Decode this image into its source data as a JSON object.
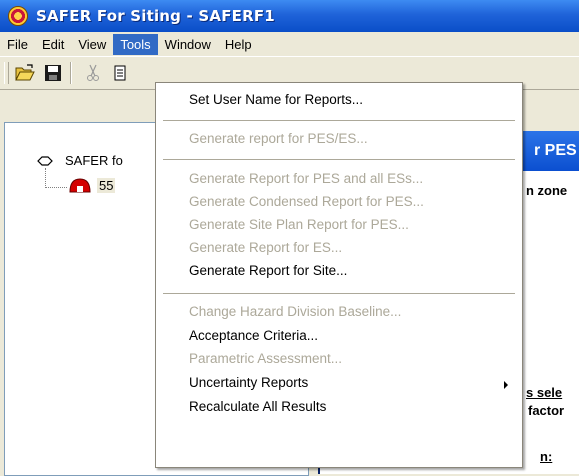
{
  "window": {
    "title": "SAFER For Siting - SAFERF1",
    "app_icon": "safer-app-icon"
  },
  "menubar": {
    "items": [
      {
        "label": "File"
      },
      {
        "label": "Edit"
      },
      {
        "label": "View"
      },
      {
        "label": "Tools",
        "active": true
      },
      {
        "label": "Window"
      },
      {
        "label": "Help"
      }
    ]
  },
  "toolbar": {
    "icons": [
      "open-folder-icon",
      "save-icon",
      "cut-icon",
      "copy-icon"
    ]
  },
  "tree": {
    "root_label": "SAFER fo",
    "child_label": "55",
    "root_icon": "site-node-icon",
    "child_icon": "pes-dome-icon"
  },
  "right_pane": {
    "header_text": "r PES",
    "line1": "n zone",
    "line2": "s sele",
    "line3": "factor",
    "line4": "n:"
  },
  "tools_menu": {
    "items": [
      {
        "label": "Set User Name for Reports...",
        "enabled": true
      },
      {
        "label": "Generate report for PES/ES...",
        "enabled": false
      },
      {
        "label": "Generate Report for PES and all ESs...",
        "enabled": false
      },
      {
        "label": "Generate Condensed Report for PES...",
        "enabled": false
      },
      {
        "label": "Generate Site Plan Report for PES...",
        "enabled": false
      },
      {
        "label": "Generate Report for ES...",
        "enabled": false
      },
      {
        "label": "Generate Report for Site...",
        "enabled": true
      },
      {
        "label": "Change Hazard Division Baseline...",
        "enabled": false
      },
      {
        "label": "Acceptance Criteria...",
        "enabled": true
      },
      {
        "label": "Parametric Assessment...",
        "enabled": false
      },
      {
        "label": "Uncertainty Reports",
        "enabled": true,
        "submenu": true
      },
      {
        "label": "Recalculate All Results",
        "enabled": true
      }
    ]
  },
  "colors": {
    "titlebar": "#0a4ec8",
    "menu_highlight": "#316ac5",
    "disabled_text": "#aca899",
    "face": "#ece9d8"
  }
}
